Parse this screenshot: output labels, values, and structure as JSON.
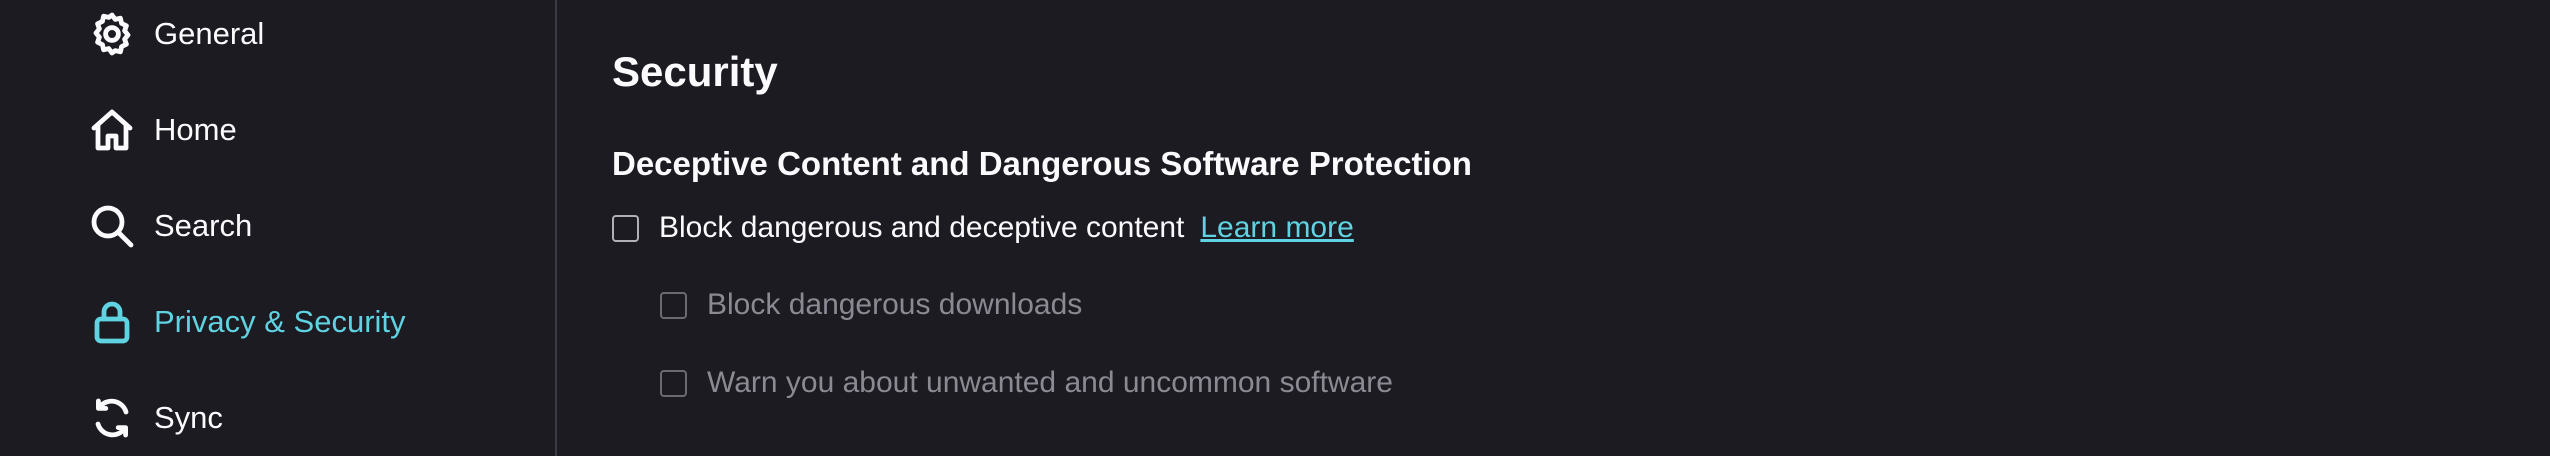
{
  "sidebar": {
    "items": [
      {
        "label": "General",
        "icon": "gear-icon"
      },
      {
        "label": "Home",
        "icon": "home-icon"
      },
      {
        "label": "Search",
        "icon": "search-icon"
      },
      {
        "label": "Privacy & Security",
        "icon": "lock-icon",
        "active": true
      },
      {
        "label": "Sync",
        "icon": "sync-icon"
      }
    ]
  },
  "main": {
    "section_title": "Security",
    "subsection_title": "Deceptive Content and Dangerous Software Protection",
    "options": [
      {
        "label": "Block dangerous and deceptive content",
        "checked": false,
        "enabled": true
      },
      {
        "label": "Block dangerous downloads",
        "checked": false,
        "enabled": false
      },
      {
        "label": "Warn you about unwanted and uncommon software",
        "checked": false,
        "enabled": false
      }
    ],
    "learn_more": "Learn more"
  },
  "colors": {
    "background": "#1c1b22",
    "text": "#fbfbfe",
    "accent": "#5fd3e2",
    "disabled_text": "#8b8a93",
    "divider": "#3a3944"
  }
}
